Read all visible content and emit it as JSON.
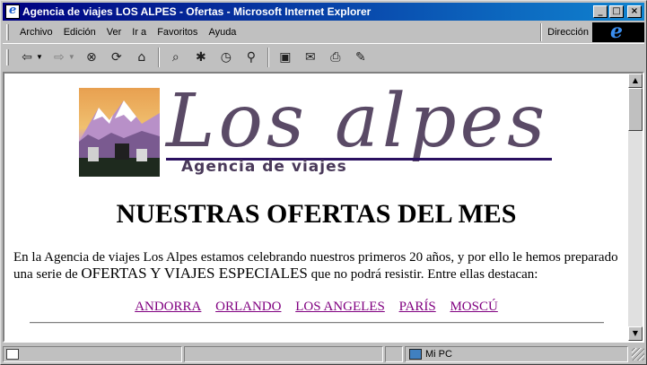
{
  "window": {
    "title": "Agencia de viajes LOS ALPES - Ofertas - Microsoft Internet Explorer",
    "minimize": "_",
    "maximize": "□",
    "close": "×"
  },
  "menu": {
    "items": [
      "Archivo",
      "Edición",
      "Ver",
      "Ir a",
      "Favoritos",
      "Ayuda"
    ],
    "address_label": "Dirección"
  },
  "toolbar": {
    "icons": [
      "back-icon",
      "forward-icon",
      "stop-icon",
      "refresh-icon",
      "home-icon",
      "search-icon",
      "favorites-icon",
      "history-icon",
      "channels-icon",
      "fullscreen-icon",
      "mail-icon",
      "print-icon",
      "edit-icon"
    ]
  },
  "page": {
    "logo_title": "Los alpes",
    "logo_subtitle": "Agencia de viajes",
    "heading": "NUESTRAS OFERTAS DEL MES",
    "intro_part1": "En la Agencia de viajes Los Alpes estamos celebrando nuestros primeros 20 años, y por ello le hemos preparado una serie de ",
    "intro_emphasis": "OFERTAS Y VIAJES ESPECIALES",
    "intro_part2": " que no podrá resistir. Entre ellas destacan:",
    "links": [
      "ANDORRA",
      "ORLANDO",
      "LOS ANGELES",
      "PARÍS",
      "MOSCÚ"
    ]
  },
  "status": {
    "zone": "Mi PC"
  },
  "colors": {
    "title_bar": "#000080",
    "link_visited": "#800080",
    "logo_text": "#5a4a66"
  }
}
